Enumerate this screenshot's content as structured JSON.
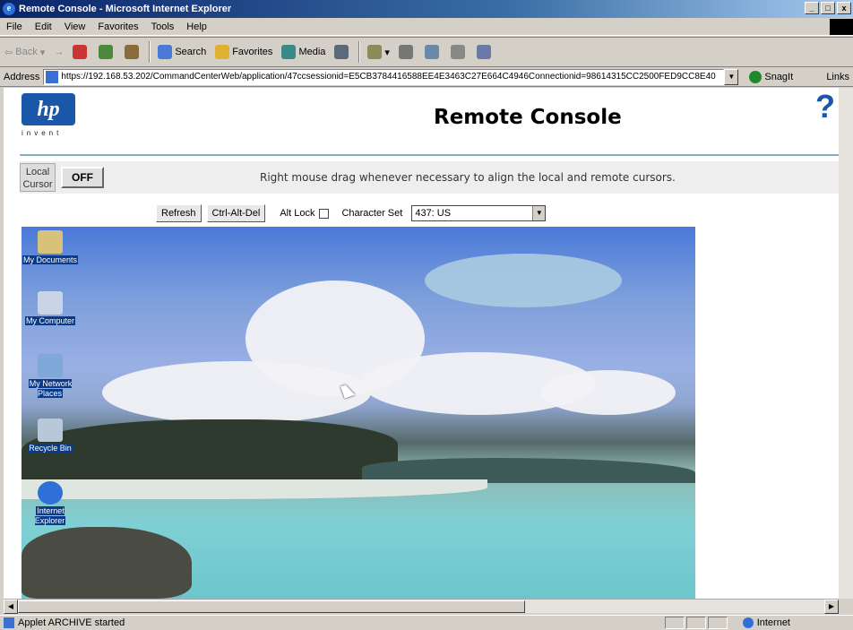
{
  "window": {
    "title": "Remote Console - Microsoft Internet Explorer",
    "min": "_",
    "max": "□",
    "close": "x"
  },
  "menu": [
    "File",
    "Edit",
    "View",
    "Favorites",
    "Tools",
    "Help"
  ],
  "toolbar": {
    "back": "Back",
    "forward": "→",
    "search": "Search",
    "favorites": "Favorites",
    "media": "Media"
  },
  "address": {
    "label": "Address",
    "url": "https://192.168.53.202/CommandCenterWeb/application/47ccsessionid=E5CB3784416588EE4E3463C27E664C4946Connectionid=98614315CC2500FED9CC8E40",
    "snagit": "SnagIt",
    "links": "Links"
  },
  "header": {
    "logo": "hp",
    "tagline": "invent",
    "title": "Remote Console",
    "help": "?"
  },
  "cursor": {
    "label": "Local Cursor",
    "state": "OFF",
    "instruction": "Right mouse drag whenever necessary to align the local and remote cursors."
  },
  "controls": {
    "refresh": "Refresh",
    "cad": "Ctrl-Alt-Del",
    "altlock": "Alt Lock",
    "charset_label": "Character Set",
    "charset_value": "437: US"
  },
  "desktop_icons": [
    {
      "label": "My Documents",
      "icon": "folder-icon",
      "color": "#d8c27a"
    },
    {
      "label": "My Computer",
      "icon": "computer-icon",
      "color": "#c9d4e6"
    },
    {
      "label": "My Network Places",
      "icon": "network-icon",
      "color": "#7fa8d8"
    },
    {
      "label": "Recycle Bin",
      "icon": "recycle-bin-icon",
      "color": "#b8c8d8"
    },
    {
      "label": "Internet Explorer",
      "icon": "ie-icon",
      "color": "#2f6fd8"
    }
  ],
  "status": {
    "text": "Applet ARCHIVE started",
    "zone": "Internet"
  }
}
